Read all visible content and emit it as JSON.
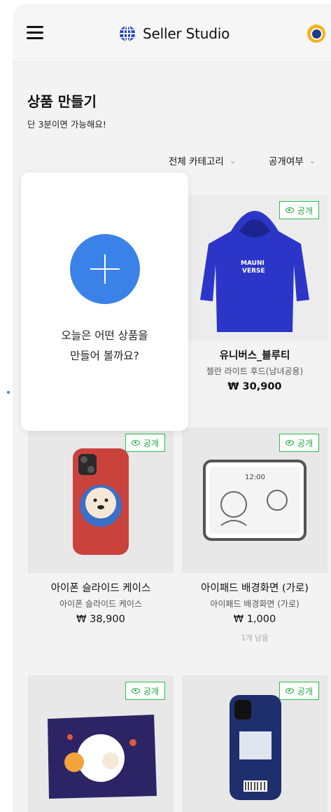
{
  "header": {
    "brand": "Seller Studio",
    "icons": {
      "menu": "hamburger-icon",
      "logo": "globe-icon",
      "profile": "avatar"
    }
  },
  "page": {
    "title": "상품 만들기",
    "subtitle": "단 3분이면 가능해요!"
  },
  "filters": {
    "category": "전체 카테고리",
    "visibility": "공개여부"
  },
  "create_prompt": {
    "line1": "오늘은 어떤 상품을",
    "line2": "만들어 볼까요?"
  },
  "colors": {
    "accent": "#3b82e8",
    "public_badge": "#27c04a",
    "background": "#f3f3f3"
  },
  "products": [
    {
      "name": "유니버스_블루티",
      "subtitle": "젤란 라이트 후드(남녀공용)",
      "price": "₩ 30,900",
      "badge": "공개",
      "thumb": "blue-hoodie"
    },
    {
      "name": "아이폰 슬라이드 케이스",
      "subtitle": "아이폰 슬라이드 케이스",
      "price": "₩ 38,900",
      "badge": "공개",
      "thumb": "red-phone-case"
    },
    {
      "name": "아이패드 배경화면 (가로)",
      "subtitle": "아이패드 배경화면 (가로)",
      "price": "₩ 1,000",
      "stock": "1개 남음",
      "badge": "공개",
      "thumb": "ipad-wallpaper"
    },
    {
      "name": "",
      "subtitle": "",
      "price": "",
      "badge": "공개",
      "thumb": "space-flag"
    },
    {
      "name": "",
      "subtitle": "",
      "price": "",
      "badge": "공개",
      "thumb": "navy-phone-case"
    }
  ]
}
